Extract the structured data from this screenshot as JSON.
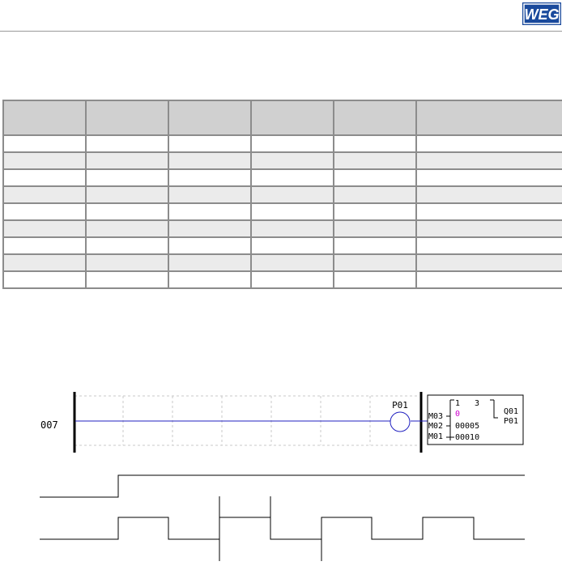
{
  "brand": {
    "logo_text": "WEG",
    "color": "#1a4a9c"
  },
  "table": {
    "columns": 6,
    "header": [
      "",
      "",
      "",
      "",
      "",
      ""
    ],
    "rows": [
      [
        "",
        "",
        "",
        "",
        "",
        ""
      ],
      [
        "",
        "",
        "",
        "",
        "",
        ""
      ],
      [
        "",
        "",
        "",
        "",
        "",
        ""
      ],
      [
        "",
        "",
        "",
        "",
        "",
        ""
      ],
      [
        "",
        "",
        "",
        "",
        "",
        ""
      ],
      [
        "",
        "",
        "",
        "",
        "",
        ""
      ],
      [
        "",
        "",
        "",
        "",
        "",
        ""
      ],
      [
        "",
        "",
        "",
        "",
        "",
        ""
      ],
      [
        "",
        "",
        "",
        "",
        "",
        ""
      ]
    ]
  },
  "ladder": {
    "line_number": "007",
    "coil_label": "P01",
    "block": {
      "top_left": "1",
      "top_right": "3",
      "inputs": [
        {
          "label": "M03",
          "value": "0",
          "value_color": "#cc00cc"
        },
        {
          "label": "M02",
          "value": "00005",
          "value_color": "#000000"
        },
        {
          "label": "M01",
          "value": "00010",
          "value_color": "#000000"
        }
      ],
      "outputs": [
        "Q01",
        "P01"
      ]
    },
    "wire_color": "#2020c0"
  }
}
